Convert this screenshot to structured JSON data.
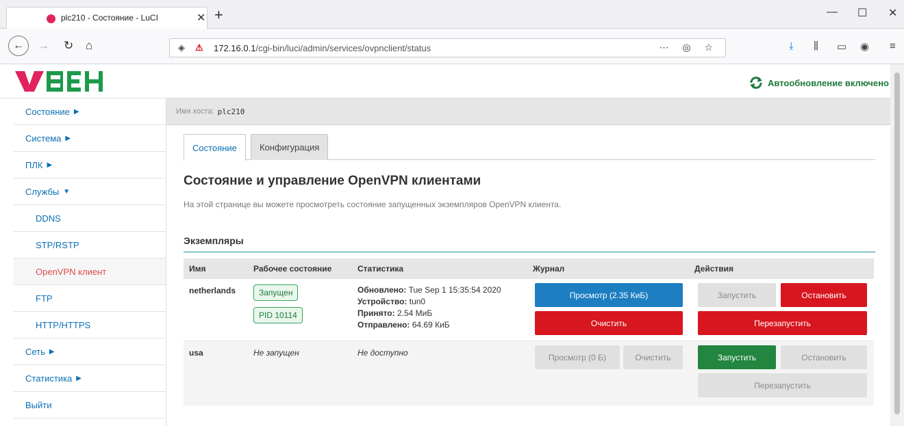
{
  "browser": {
    "tab_title": "plc210 - Состояние - LuCI",
    "url_host": "172.16.0.1",
    "url_path": "/cgi-bin/luci/admin/services/ovpnclient/status"
  },
  "header": {
    "autorefresh": "Автообновление включено"
  },
  "sidebar": {
    "items": [
      {
        "label": "Состояние",
        "caret": "right"
      },
      {
        "label": "Система",
        "caret": "right"
      },
      {
        "label": "ПЛК",
        "caret": "right"
      },
      {
        "label": "Службы",
        "caret": "down"
      },
      {
        "label": "DDNS"
      },
      {
        "label": "STP/RSTP"
      },
      {
        "label": "OpenVPN клиент",
        "active": true
      },
      {
        "label": "FTP"
      },
      {
        "label": "HTTP/HTTPS"
      },
      {
        "label": "Сеть",
        "caret": "right"
      },
      {
        "label": "Статистика",
        "caret": "right"
      },
      {
        "label": "Выйти"
      }
    ]
  },
  "hostbar": {
    "label": "Имя хоста:",
    "value": "plc210"
  },
  "tabs": [
    "Состояние",
    "Конфигурация"
  ],
  "page": {
    "title": "Состояние и управление OpenVPN клиентами",
    "description": "На этой странице вы можете просмотреть состояние запущенных экземпляров OpenVPN клиента.",
    "section_title": "Экземпляры"
  },
  "table": {
    "headers": [
      "Имя",
      "Рабочее состояние",
      "Статистика",
      "Журнал",
      "Действия"
    ],
    "rows": [
      {
        "name": "netherlands",
        "state": "Запущен",
        "pid": "PID 10114",
        "updated_label": "Обновлено:",
        "updated_value": "Tue Sep 1 15:35:54 2020",
        "device_label": "Устройство:",
        "device_value": "tun0",
        "received_label": "Принято:",
        "received_value": "2.54 МиБ",
        "sent_label": "Отправлено:",
        "sent_value": "64.69 КиБ",
        "view_label": "Просмотр (2.35 КиБ)",
        "clear_label": "Очистить",
        "start_label": "Запустить",
        "stop_label": "Остановить",
        "restart_label": "Перезапустить"
      },
      {
        "name": "usa",
        "state": "Не запущен",
        "stats": "Не доступно",
        "view_label": "Просмотр (0 Б)",
        "clear_label": "Очистить",
        "start_label": "Запустить",
        "stop_label": "Остановить",
        "restart_label": "Перезапустить"
      }
    ]
  },
  "colors": {
    "link": "#0a6fb5",
    "active": "#e24a4a",
    "primary": "#1d7ec2",
    "danger": "#d8161f",
    "success": "#228540",
    "accent_line": "#1a8f8f"
  }
}
